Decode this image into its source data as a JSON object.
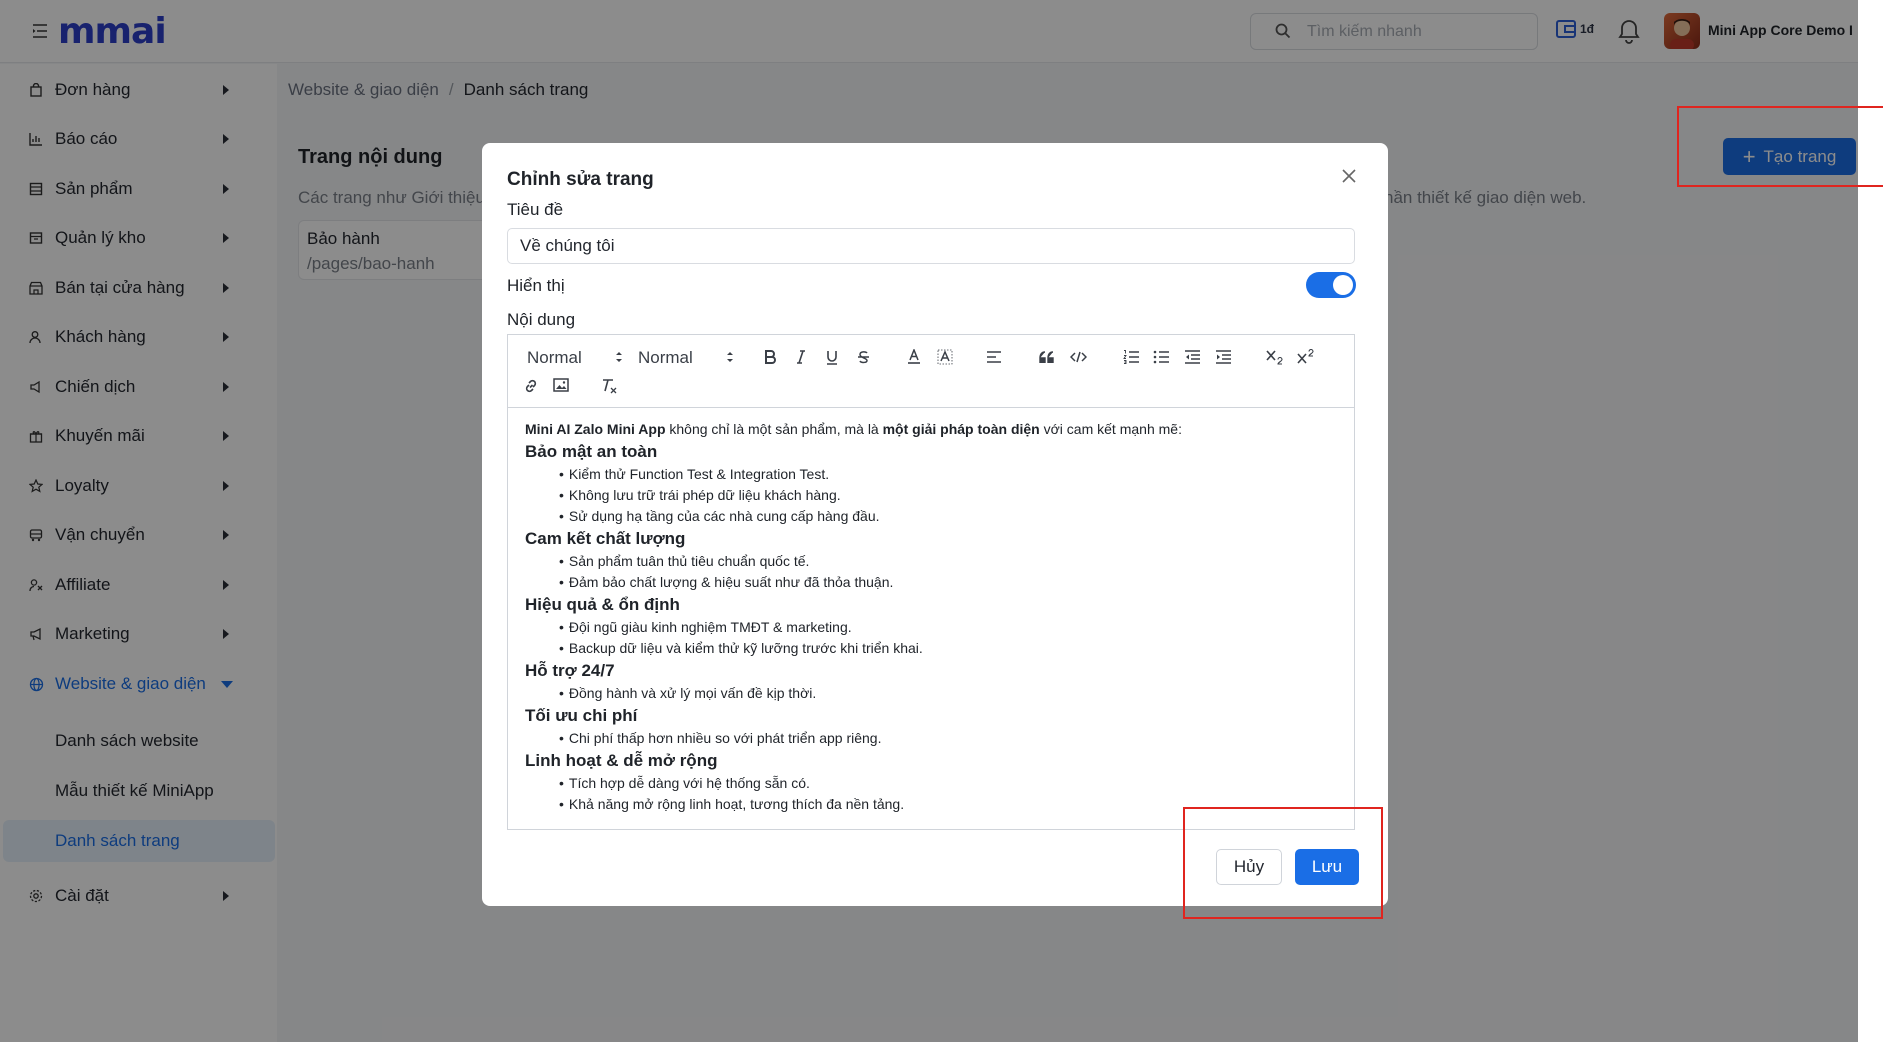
{
  "header": {
    "logo_text": "mmai",
    "search_placeholder": "Tìm kiếm nhanh",
    "wallet_label": "1đ",
    "account_name": "Mini App Core Demo I"
  },
  "sidebar": {
    "items": [
      {
        "label": "Đơn hàng",
        "icon": "shopping-bag-icon"
      },
      {
        "label": "Báo cáo",
        "icon": "bar-chart-icon"
      },
      {
        "label": "Sản phẩm",
        "icon": "box-icon"
      },
      {
        "label": "Quản lý kho",
        "icon": "warehouse-icon"
      },
      {
        "label": "Bán tại cửa hàng",
        "icon": "store-icon"
      },
      {
        "label": "Khách hàng",
        "icon": "users-icon"
      },
      {
        "label": "Chiến dịch",
        "icon": "megaphone-icon"
      },
      {
        "label": "Khuyến mãi",
        "icon": "gift-icon"
      },
      {
        "label": "Loyalty",
        "icon": "star-icon"
      },
      {
        "label": "Vận chuyển",
        "icon": "truck-icon"
      },
      {
        "label": "Affiliate",
        "icon": "affiliate-icon"
      },
      {
        "label": "Marketing",
        "icon": "marketing-icon"
      },
      {
        "label": "Website & giao diện",
        "icon": "globe-icon"
      }
    ],
    "subitems": [
      {
        "label": "Danh sách website"
      },
      {
        "label": "Mẫu thiết kế MiniApp"
      },
      {
        "label": "Danh sách trang"
      }
    ],
    "settings_label": "Cài đặt",
    "accent": "#1a6ee6"
  },
  "breadcrumb": {
    "parent": "Website & giao diện",
    "separator": "/",
    "current": "Danh sách trang"
  },
  "main": {
    "title": "Trang nội dung",
    "desc_start": "Các trang như Giới thiệu,",
    "desc_end": "hần thiết kế giao diện web.",
    "create_button": "Tạo trang",
    "page_card": {
      "name": "Bảo hành",
      "path": "/pages/bao-hanh"
    }
  },
  "modal": {
    "title": "Chỉnh sửa trang",
    "title_label": "Tiêu đề",
    "title_value": "Về chúng tôi",
    "visible_label": "Hiển thị",
    "visible_on": true,
    "content_label": "Nội dung",
    "toolbar": {
      "font_select": "Normal",
      "size_select": "Normal"
    },
    "content": {
      "intro_b1": "Mini AI Zalo Mini App",
      "intro_t1": " không chỉ là một sản phẩm, mà là ",
      "intro_b2": "một giải pháp toàn diện",
      "intro_t2": " với cam kết mạnh mẽ:",
      "sections": [
        {
          "heading": "Bảo mật an toàn",
          "items": [
            "Kiểm thử Function Test & Integration Test.",
            "Không lưu trữ trái phép dữ liệu khách hàng.",
            "Sử dụng hạ tầng của các nhà cung cấp hàng đầu."
          ]
        },
        {
          "heading": "Cam kết chất lượng",
          "items": [
            "Sản phẩm tuân thủ tiêu chuẩn quốc tế.",
            "Đảm bảo chất lượng & hiệu suất như đã thỏa thuận."
          ]
        },
        {
          "heading": "Hiệu quả & ổn định",
          "items": [
            "Đội ngũ giàu kinh nghiệm TMĐT & marketing.",
            "Backup dữ liệu và kiểm thử kỹ lưỡng trước khi triển khai."
          ]
        },
        {
          "heading": "Hỗ trợ 24/7",
          "items": [
            "Đồng hành và xử lý mọi vấn đề kịp thời."
          ]
        },
        {
          "heading": "Tối ưu chi phí",
          "items": [
            "Chi phí thấp hơn nhiều so với phát triển app riêng."
          ]
        },
        {
          "heading": "Linh hoạt & dễ mở rộng",
          "items": [
            "Tích hợp dễ dàng với hệ thống sẵn có.",
            "Khả năng mở rộng linh hoạt, tương thích đa nền tảng."
          ]
        }
      ]
    },
    "cancel_label": "Hủy",
    "save_label": "Lưu"
  },
  "colors": {
    "primary": "#1a6ee6",
    "highlight": "#e0251f",
    "brand": "#2c3ec8"
  }
}
